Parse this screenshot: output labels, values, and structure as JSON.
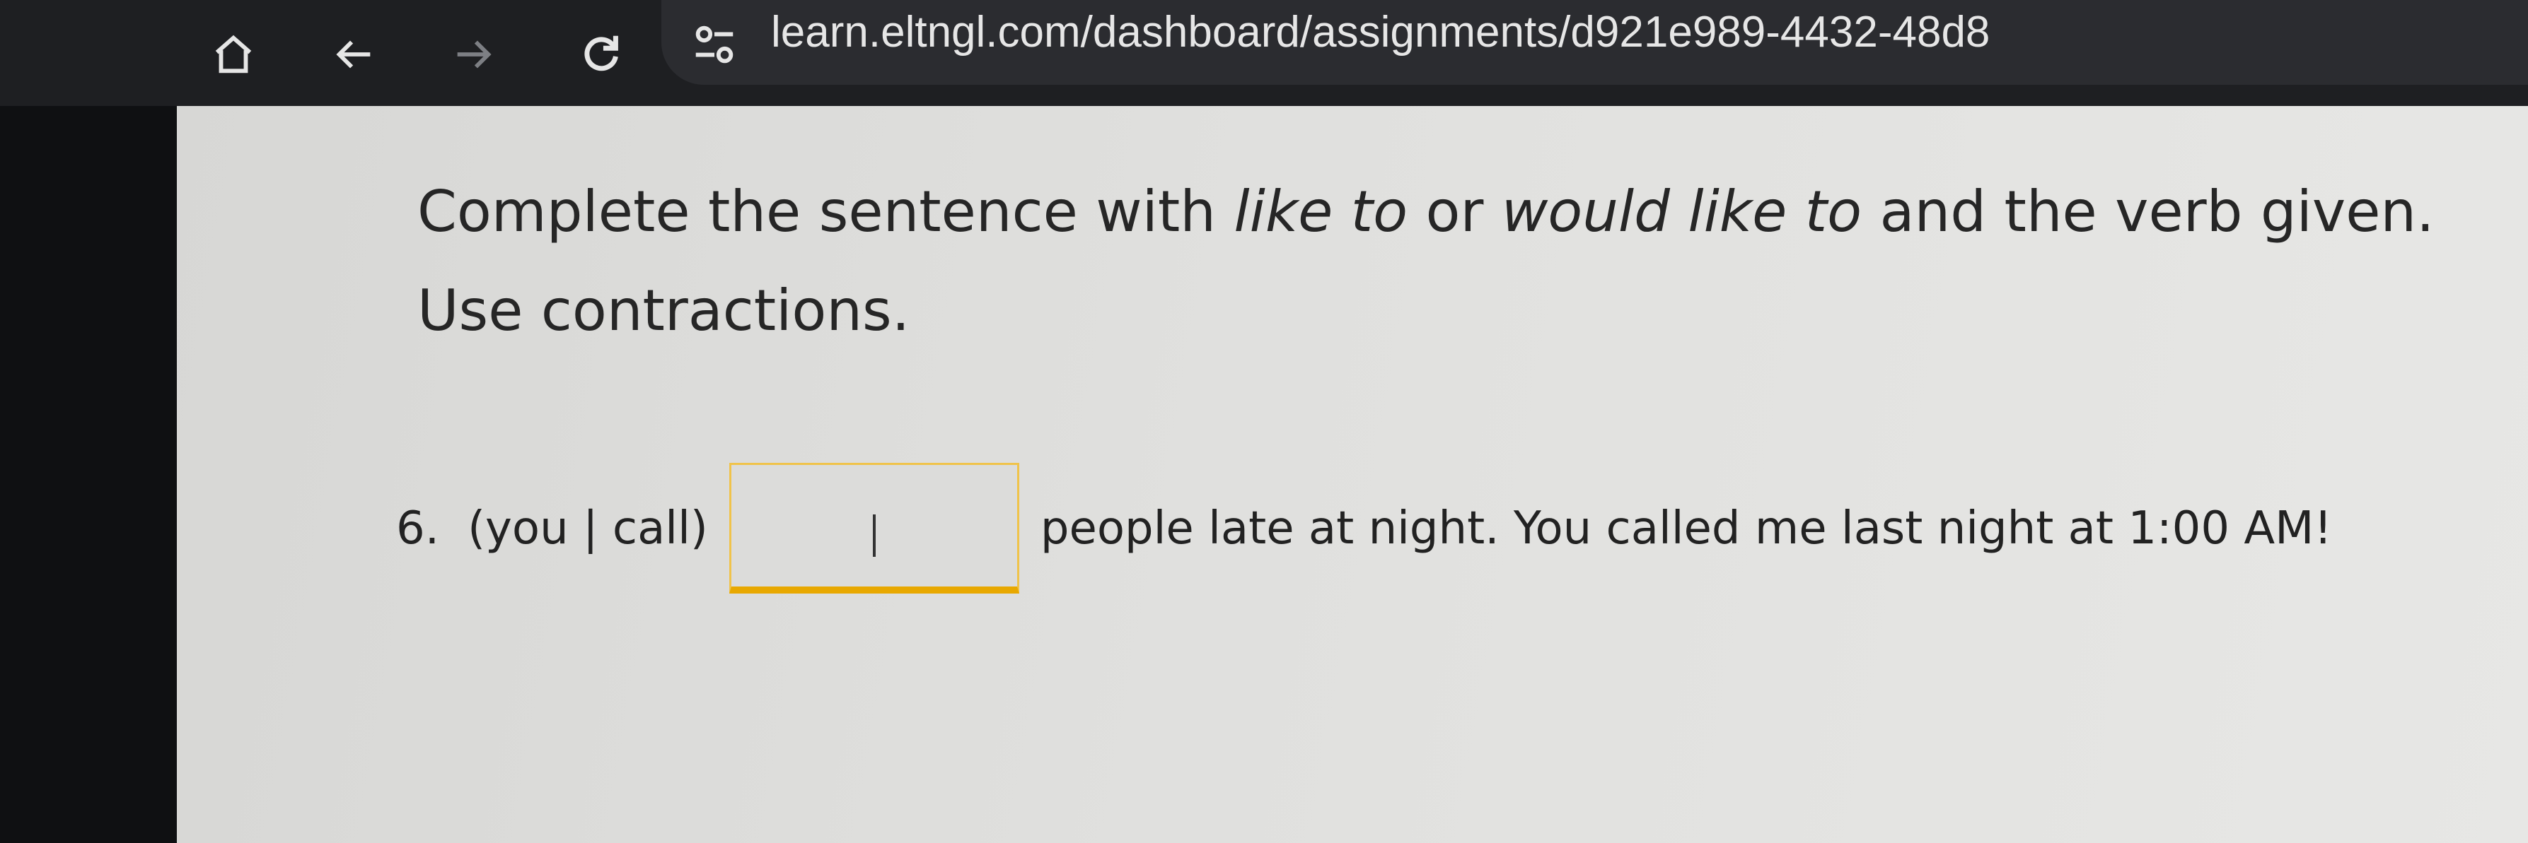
{
  "browser": {
    "url": "learn.eltngl.com/dashboard/assignments/d921e989-4432-48d8",
    "icons": [
      "home-icon",
      "back-arrow-icon",
      "forward-arrow-icon",
      "reload-icon",
      "site-settings-icon"
    ]
  },
  "exercise": {
    "instruction_part1": "Complete the sentence with ",
    "instruction_em1": "like to",
    "instruction_part2": " or ",
    "instruction_em2": "would like to",
    "instruction_part3": " and the verb given. Use contractions.",
    "question_number": "6.",
    "question_prompt": "(you | call)",
    "answer_value": "",
    "question_rest": "people late at night. You called me last night at 1:00 AM!"
  },
  "colors": {
    "answer_border": "#f0c34a",
    "answer_underline": "#e8a800",
    "page_background": "#e0e0de",
    "chrome_background": "#1e1f22"
  }
}
